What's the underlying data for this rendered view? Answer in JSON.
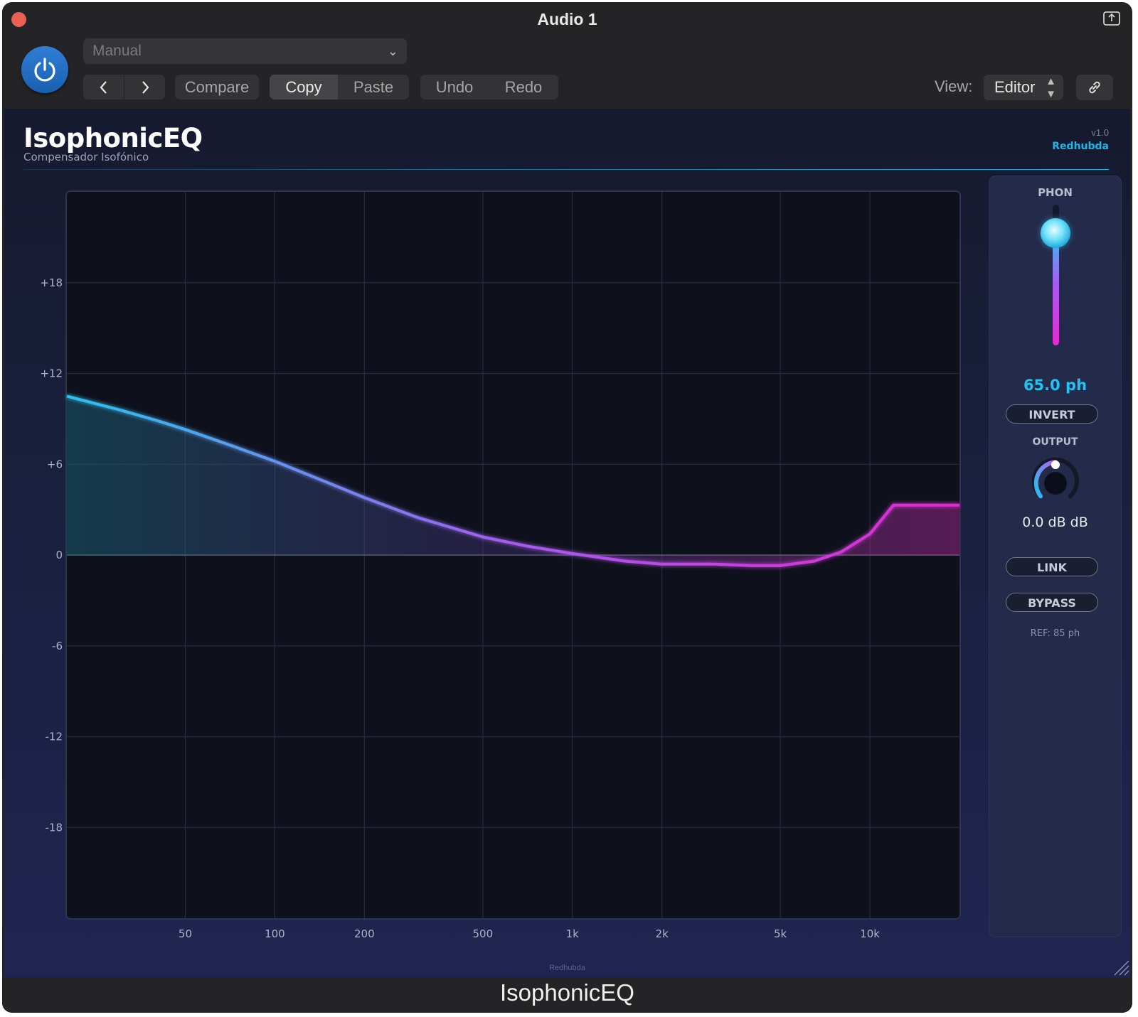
{
  "window": {
    "title": "Audio 1"
  },
  "toolbar": {
    "preset": "Manual",
    "compare": "Compare",
    "copy": "Copy",
    "paste": "Paste",
    "undo": "Undo",
    "redo": "Redo",
    "view_label": "View:",
    "view_value": "Editor"
  },
  "plugin": {
    "title": "IsophonicEQ",
    "subtitle": "Compensador Isofónico",
    "version": "v1.0",
    "brand": "Redhubda",
    "footer_brand": "Redhubda"
  },
  "chart_data": {
    "type": "line",
    "x_scale": "log",
    "xlim": [
      20,
      20000
    ],
    "ylim": [
      -24,
      24
    ],
    "x_ticks": [
      {
        "value": 50,
        "label": "50"
      },
      {
        "value": 100,
        "label": "100"
      },
      {
        "value": 200,
        "label": "200"
      },
      {
        "value": 500,
        "label": "500"
      },
      {
        "value": 1000,
        "label": "1k"
      },
      {
        "value": 2000,
        "label": "2k"
      },
      {
        "value": 5000,
        "label": "5k"
      },
      {
        "value": 10000,
        "label": "10k"
      }
    ],
    "y_ticks": [
      {
        "value": 18,
        "label": "+18"
      },
      {
        "value": 12,
        "label": "+12"
      },
      {
        "value": 6,
        "label": "+6"
      },
      {
        "value": 0,
        "label": "0"
      },
      {
        "value": -6,
        "label": "-6"
      },
      {
        "value": -12,
        "label": "-12"
      },
      {
        "value": -18,
        "label": "-18"
      }
    ],
    "grid": true,
    "series": [
      {
        "points": [
          [
            20,
            10.5
          ],
          [
            30,
            9.6
          ],
          [
            40,
            8.9
          ],
          [
            50,
            8.3
          ],
          [
            70,
            7.3
          ],
          [
            100,
            6.2
          ],
          [
            150,
            4.8
          ],
          [
            200,
            3.8
          ],
          [
            300,
            2.5
          ],
          [
            500,
            1.2
          ],
          [
            700,
            0.6
          ],
          [
            1000,
            0.1
          ],
          [
            1500,
            -0.4
          ],
          [
            2000,
            -0.6
          ],
          [
            3000,
            -0.6
          ],
          [
            4000,
            -0.7
          ],
          [
            5000,
            -0.7
          ],
          [
            6500,
            -0.4
          ],
          [
            8000,
            0.2
          ],
          [
            10000,
            1.4
          ],
          [
            12000,
            3.3
          ],
          [
            20000,
            3.3
          ]
        ]
      }
    ]
  },
  "controls": {
    "phon_label": "PHON",
    "phon_value_text": "65.0 ph",
    "phon_level": 0.85,
    "invert": "INVERT",
    "output_label": "OUTPUT",
    "output_value_text": "0.0 dB dB",
    "link": "LINK",
    "bypass": "BYPASS",
    "ref": "REF: 85 ph"
  },
  "bottom": {
    "title": "IsophonicEQ"
  },
  "colors": {
    "accent_blue": "#1fb6e6",
    "curve_start": "#2cc3ee",
    "curve_mid": "#a45cf0",
    "curve_end": "#e22ad0",
    "power": "#2f7fd6"
  }
}
